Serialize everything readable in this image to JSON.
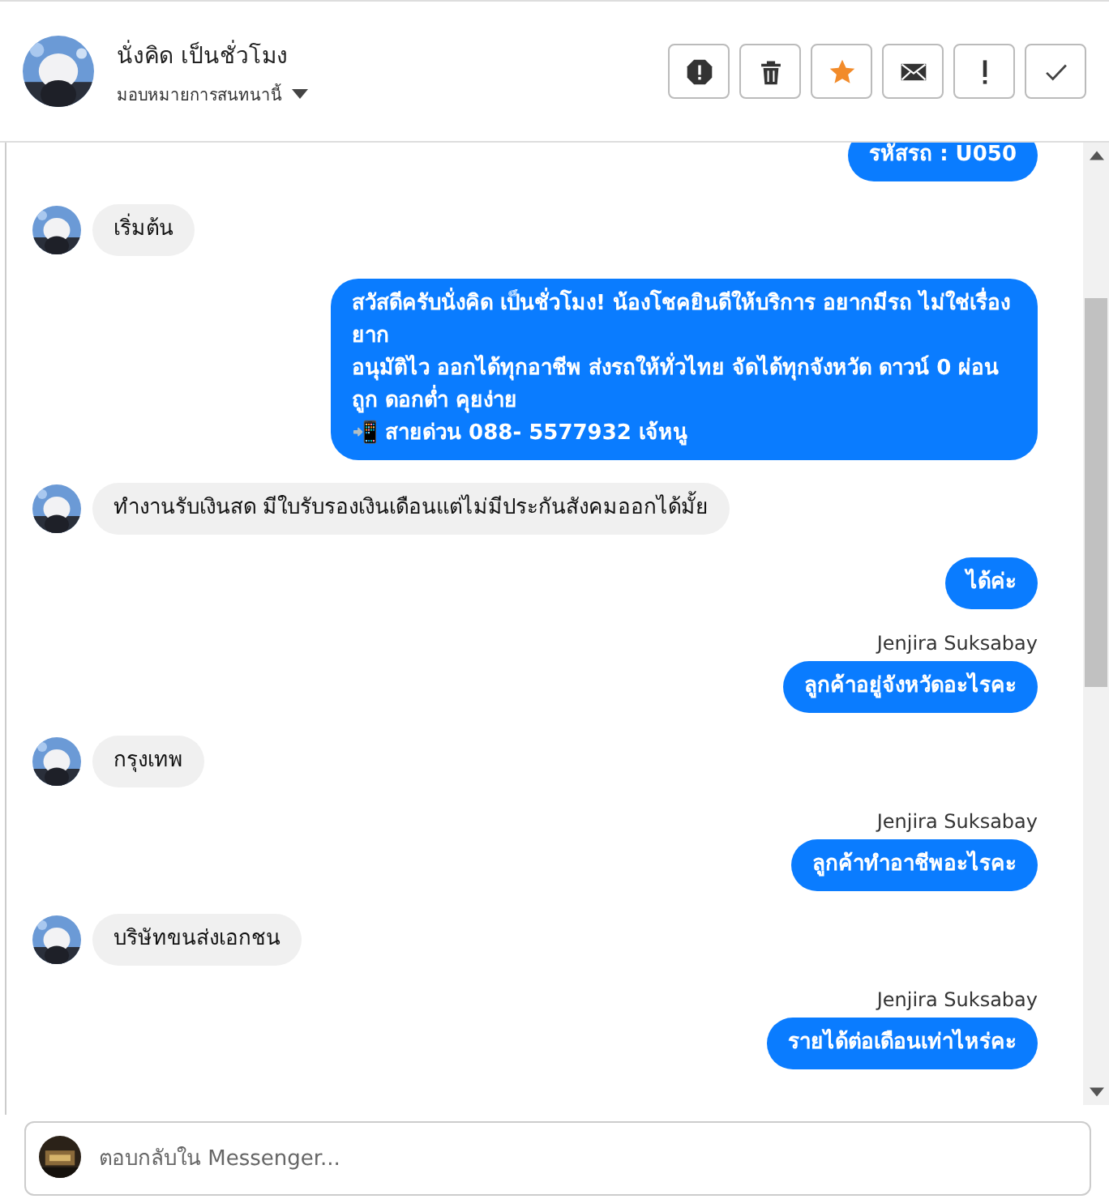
{
  "header": {
    "name": "นั่งคิด เป็นชั่วโมง",
    "assign_label": "มอบหมายการสนทนานี้",
    "actions": [
      {
        "kind": "alert"
      },
      {
        "kind": "trash"
      },
      {
        "kind": "star"
      },
      {
        "kind": "mail"
      },
      {
        "kind": "exclaim"
      },
      {
        "kind": "check"
      }
    ]
  },
  "messages": [
    {
      "kind": "outgoing",
      "text": "รหัสรถ : U050"
    },
    {
      "kind": "incoming",
      "text": "เริ่มต้น"
    },
    {
      "kind": "outgoing",
      "text": "สวัสดีครับนั่งคิด เป็นชั่วโมง! น้องโชคยินดีให้บริการ อยากมีรถ ไม่ใช่เรื่องยาก\nอนุมัติไว ออกได้ทุกอาชีพ ส่งรถให้ทั่วไทย จัดได้ทุกจังหวัด ดาวน์ 0 ผ่อนถูก ดอกต่ำ คุยง่าย\n📲 สายด่วน 088- 5577932 เจ้หนู"
    },
    {
      "kind": "incoming",
      "text": "ทำงานรับเงินสด มีใบรับรองเงินเดือนแต่ไม่มีประกันสังคมออกได้มั้ย"
    },
    {
      "kind": "outgoing",
      "text": "ได้ค่ะ"
    },
    {
      "kind": "outgoing",
      "sender": "Jenjira Suksabay",
      "text": "ลูกค้าอยู่จังหวัดอะไรคะ"
    },
    {
      "kind": "incoming",
      "text": "กรุงเทพ"
    },
    {
      "kind": "outgoing",
      "sender": "Jenjira Suksabay",
      "text": "ลูกค้าทำอาชีพอะไรคะ"
    },
    {
      "kind": "incoming",
      "text": "บริษัทขนส่งเอกชน"
    },
    {
      "kind": "outgoing",
      "sender": "Jenjira Suksabay",
      "text": "รายได้ต่อเดือนเท่าไหร่คะ"
    }
  ],
  "composer": {
    "placeholder": "ตอบกลับใน Messenger..."
  }
}
